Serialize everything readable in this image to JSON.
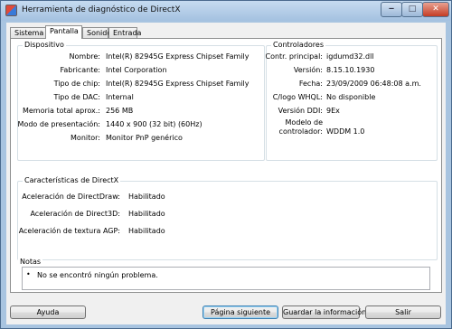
{
  "window": {
    "title": "Herramienta de diagnóstico de DirectX"
  },
  "tabs": [
    {
      "label": "Sistema",
      "active": false
    },
    {
      "label": "Pantalla",
      "active": true
    },
    {
      "label": "Sonido",
      "active": false
    },
    {
      "label": "Entrada",
      "active": false
    }
  ],
  "device": {
    "legend": "Dispositivo",
    "rows": [
      {
        "label": "Nombre:",
        "value": "Intel(R) 82945G Express Chipset Family"
      },
      {
        "label": "Fabricante:",
        "value": "Intel Corporation"
      },
      {
        "label": "Tipo de chip:",
        "value": "Intel(R) 82945G Express Chipset Family"
      },
      {
        "label": "Tipo de DAC:",
        "value": "Internal"
      },
      {
        "label": "Memoria total aprox.:",
        "value": "256 MB"
      },
      {
        "label": "Modo de presentación:",
        "value": "1440 x 900 (32 bit) (60Hz)"
      },
      {
        "label": "Monitor:",
        "value": "Monitor PnP genérico"
      }
    ]
  },
  "drivers": {
    "legend": "Controladores",
    "rows": [
      {
        "label": "Contr. principal:",
        "value": "igdumd32.dll"
      },
      {
        "label": "Versión:",
        "value": "8.15.10.1930"
      },
      {
        "label": "Fecha:",
        "value": "23/09/2009 06:48:08 a.m."
      },
      {
        "label": "C/logo WHQL:",
        "value": "No disponible"
      },
      {
        "label": "Versión DDI:",
        "value": "9Ex"
      },
      {
        "label": "Modelo de",
        "value": ""
      },
      {
        "label": "controlador:",
        "value": "WDDM 1.0"
      }
    ]
  },
  "directx": {
    "legend": "Características de DirectX",
    "rows": [
      {
        "label": "Aceleración de DirectDraw:",
        "value": "Habilitado"
      },
      {
        "label": "Aceleración de Direct3D:",
        "value": "Habilitado"
      },
      {
        "label": "Aceleración de textura AGP:",
        "value": "Habilitado"
      }
    ]
  },
  "notes": {
    "legend": "Notas",
    "bullet": "•",
    "text": "No se encontró ningún problema."
  },
  "buttons": {
    "help": "Ayuda",
    "next": "Página siguiente",
    "save": "Guardar la información...",
    "exit": "Salir"
  }
}
